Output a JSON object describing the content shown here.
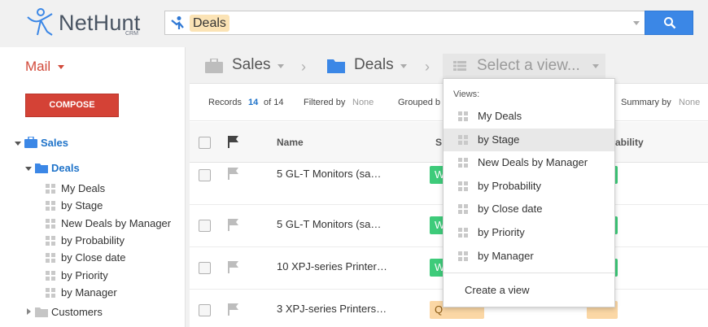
{
  "header": {
    "logo_name": "NetHunt",
    "logo_sub": "CRM",
    "search_chip": "Deals"
  },
  "sidebar": {
    "mail_label": "Mail",
    "compose_label": "COMPOSE",
    "tree": {
      "sales": "Sales",
      "deals": "Deals",
      "views": [
        "My Deals",
        "by Stage",
        "New Deals by Manager",
        "by Probability",
        "by Close date",
        "by Priority",
        "by Manager"
      ],
      "customers": "Customers"
    }
  },
  "breadcrumb": {
    "workspace": "Sales",
    "folder": "Deals",
    "view_placeholder": "Select a view..."
  },
  "toolbar": {
    "records_label": "Records",
    "records_count": "14",
    "records_of": "of 14",
    "filtered_label": "Filtered by",
    "filtered_value": "None",
    "grouped_label": "Grouped b",
    "summary_label": "Summary by",
    "summary_value": "None"
  },
  "table": {
    "col_name": "Name",
    "col_stage": "S",
    "col_probability": "ability",
    "rows": [
      {
        "name": "5 GL-T Monitors (sa…",
        "stage": "W",
        "stage_color": "#3ecb7a",
        "prob_color": "#3ecb7a"
      },
      {
        "name": "5 GL-T Monitors (sa…",
        "stage": "W",
        "stage_color": "#3ecb7a",
        "prob_color": "#3ecb7a"
      },
      {
        "name": "10 XPJ-series Printer…",
        "stage": "W",
        "stage_color": "#3ecb7a",
        "prob_color": "#3ecb7a"
      },
      {
        "name": "3 XPJ-series Printers…",
        "stage": "Q",
        "stage_color": "#fbd7a5",
        "prob_color": "#fbd7a5"
      }
    ]
  },
  "dropdown": {
    "header": "Views:",
    "items": [
      "My Deals",
      "by Stage",
      "New Deals by Manager",
      "by Probability",
      "by Close date",
      "by Priority",
      "by Manager"
    ],
    "active_index": 1,
    "create_label": "Create a view"
  },
  "colors": {
    "accent_blue": "#3b87e6",
    "compose_red": "#d44236",
    "mail_red": "#d24a3a",
    "link_blue": "#1f73c9"
  }
}
